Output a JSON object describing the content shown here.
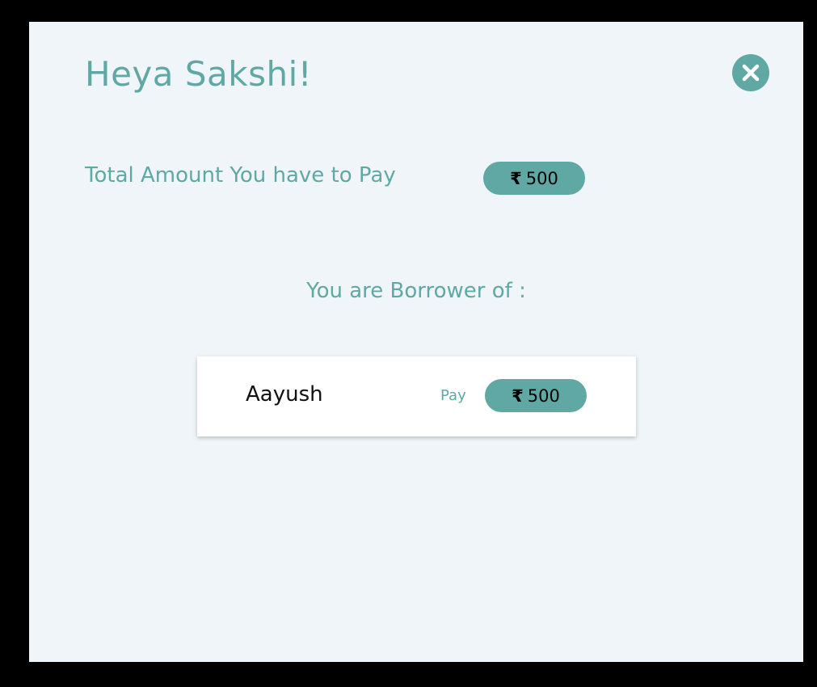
{
  "modal": {
    "greeting": "Heya Sakshi!",
    "close_icon": "close-icon",
    "total": {
      "label": "Total Amount You have to Pay",
      "currency_symbol": "₹",
      "amount": "500"
    },
    "borrower_heading": "You are Borrower of :",
    "borrowers": [
      {
        "name": "Aayush",
        "action_label": "Pay",
        "currency_symbol": "₹",
        "amount": "500"
      }
    ]
  },
  "colors": {
    "accent": "#5fa8a4",
    "modal_background": "#eff5f8",
    "card_background": "#ffffff",
    "backdrop": "#000000"
  }
}
